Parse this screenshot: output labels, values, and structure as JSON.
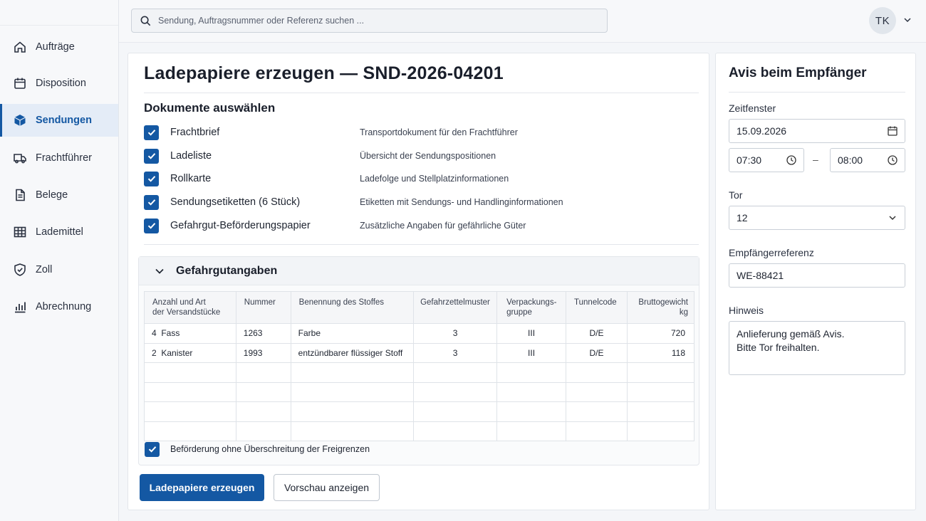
{
  "search": {
    "placeholder": "Sendung, Auftragsnummer oder Referenz suchen ..."
  },
  "user": {
    "initials": "TK"
  },
  "sidebar": {
    "items": [
      {
        "label": "Aufträge",
        "icon": "home-icon"
      },
      {
        "label": "Disposition",
        "icon": "calendar-icon"
      },
      {
        "label": "Sendungen",
        "icon": "box-icon",
        "active": true
      },
      {
        "label": "Frachtführer",
        "icon": "truck-icon"
      },
      {
        "label": "Belege",
        "icon": "document-icon"
      },
      {
        "label": "Lademittel",
        "icon": "grid-icon"
      },
      {
        "label": "Zoll",
        "icon": "shield-icon"
      },
      {
        "label": "Abrechnung",
        "icon": "bar-chart-icon"
      }
    ]
  },
  "main": {
    "title": "Ladepapiere erzeugen — SND-2026-04201",
    "documents_heading": "Dokumente auswählen",
    "documents": [
      {
        "label": "Frachtbrief",
        "description": "Transportdokument für den Frachtführer",
        "checked": true
      },
      {
        "label": "Ladeliste",
        "description": "Übersicht der Sendungspositionen",
        "checked": true
      },
      {
        "label": "Rollkarte",
        "description": "Ladefolge und Stellplatzinformationen",
        "checked": true
      },
      {
        "label": "Sendungsetiketten (6 Stück)",
        "description": "Etiketten mit Sendungs- und Handlinginformationen",
        "checked": true
      },
      {
        "label": "Gefahrgut-Beförderungspapier",
        "description": "Zusätzliche Angaben für gefährliche Güter",
        "checked": true
      }
    ],
    "hazmat": {
      "heading": "Gefahrgutangaben",
      "columns": {
        "anzahl_line1": "Anzahl und Art",
        "anzahl_line2": "der Versandstücke",
        "nummer": "Nummer",
        "benennung": "Benennung des Stoffes",
        "gefahrzettel": "Gefahrzettelmuster",
        "verpackung_line1": "Verpackungs-",
        "verpackung_line2": "gruppe",
        "tunnel": "Tunnelcode",
        "gewicht_line1": "Bruttogewicht",
        "gewicht_line2": "kg"
      },
      "rows": [
        {
          "anzahl": "4  Fass",
          "nummer": "1263",
          "benennung": "Farbe",
          "gefahrzettel": "3",
          "verpackung": "III",
          "tunnel": "D/E",
          "gewicht": "720"
        },
        {
          "anzahl": "2  Kanister",
          "nummer": "1993",
          "benennung": "entzündbarer flüssiger Stoff",
          "gefahrzettel": "3",
          "verpackung": "III",
          "tunnel": "D/E",
          "gewicht": "118"
        }
      ],
      "limit_label": "Beförderung ohne Überschreitung der Freigrenzen",
      "limit_checked": true
    },
    "buttons": {
      "generate": "Ladepapiere erzeugen",
      "preview": "Vorschau anzeigen"
    }
  },
  "avis": {
    "title": "Avis beim Empfänger",
    "zeitfenster_label": "Zeitfenster",
    "date": "15.09.2026",
    "time_from": "07:30",
    "time_separator": "–",
    "time_to": "08:00",
    "tor_label": "Tor",
    "tor_value": "12",
    "referenz_label": "Empfängerreferenz",
    "referenz_value": "WE-88421",
    "hinweis_label": "Hinweis",
    "hinweis_line1": "Anlieferung gemäß Avis.",
    "hinweis_line2": "Bitte Tor freihalten."
  },
  "colors": {
    "accent": "#1458a3",
    "active_nav_bg": "#e4ecf7"
  }
}
